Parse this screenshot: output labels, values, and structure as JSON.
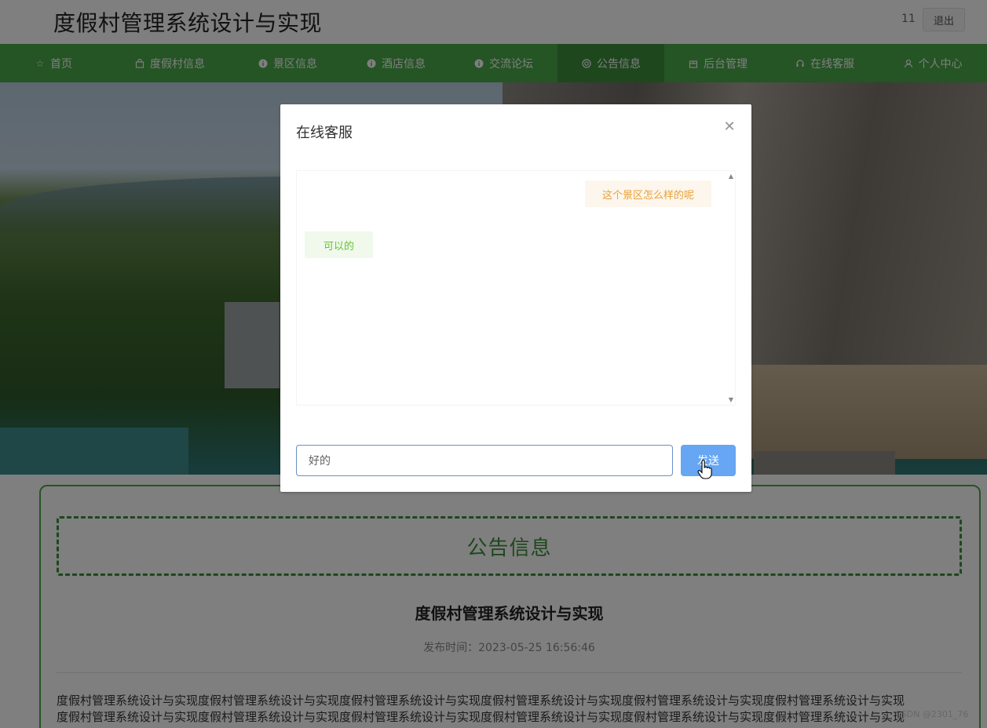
{
  "header": {
    "site_title": "度假村管理系统设计与实现",
    "username": "11",
    "logout_label": "退出"
  },
  "nav": {
    "items": [
      {
        "label": "首页",
        "icon": "star-icon"
      },
      {
        "label": "度假村信息",
        "icon": "bag-icon"
      },
      {
        "label": "景区信息",
        "icon": "info-icon"
      },
      {
        "label": "酒店信息",
        "icon": "info-icon"
      },
      {
        "label": "交流论坛",
        "icon": "info-icon"
      },
      {
        "label": "公告信息",
        "icon": "bell-icon"
      },
      {
        "label": "后台管理",
        "icon": "box-icon"
      },
      {
        "label": "在线客服",
        "icon": "headset-icon"
      },
      {
        "label": "个人中心",
        "icon": "user-icon"
      }
    ],
    "active_index": 5
  },
  "content": {
    "section_title": "公告信息",
    "article_title": "度假村管理系统设计与实现",
    "publish_time": "发布时间：2023-05-25 16:56:46",
    "body_line_1": "度假村管理系统设计与实现度假村管理系统设计与实现度假村管理系统设计与实现度假村管理系统设计与实现度假村管理系统设计与实现度假村管理系统设计与实现",
    "body_line_2": "度假村管理系统设计与实现度假村管理系统设计与实现度假村管理系统设计与实现度假村管理系统设计与实现度假村管理系统设计与实现度假村管理系统设计与实现"
  },
  "dialog": {
    "title": "在线客服",
    "messages": [
      {
        "side": "right",
        "text": "这个景区怎么样的呢"
      },
      {
        "side": "left",
        "text": "可以的"
      }
    ],
    "input_value": "好的",
    "send_label": "发送"
  },
  "watermark": "CSDN @2301_76"
}
